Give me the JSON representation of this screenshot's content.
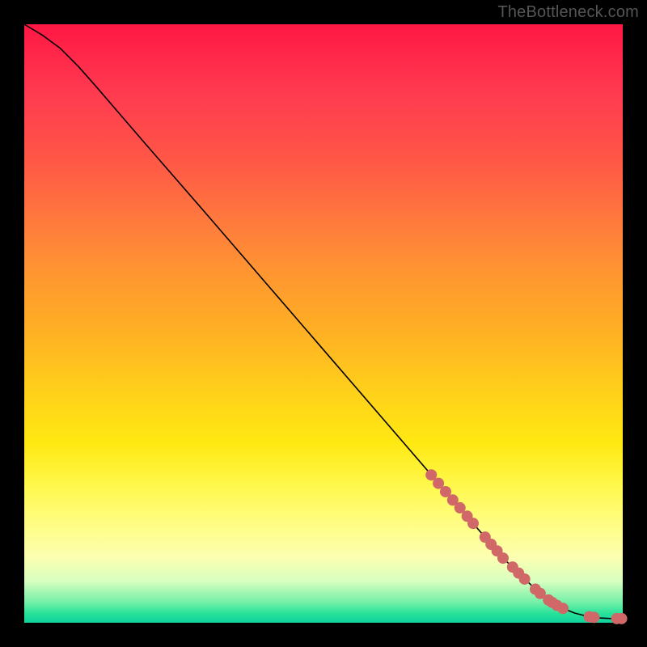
{
  "watermark": "TheBottleneck.com",
  "colors": {
    "black": "#000000",
    "marker": "#d16868",
    "gradient_top": "#ff1744",
    "gradient_bottom": "#0fd29c"
  },
  "chart_data": {
    "type": "line",
    "title": "",
    "xlabel": "",
    "ylabel": "",
    "xlim": [
      0,
      100
    ],
    "ylim": [
      0,
      100
    ],
    "series": [
      {
        "name": "curve",
        "x": [
          0,
          3,
          6,
          9,
          12,
          20,
          30,
          40,
          50,
          60,
          70,
          80,
          85,
          88,
          90,
          92,
          94,
          96,
          98,
          100
        ],
        "y": [
          100,
          98.2,
          96.0,
          93.0,
          89.6,
          80.3,
          68.8,
          57.2,
          45.6,
          34.0,
          22.4,
          10.8,
          6.0,
          3.6,
          2.4,
          1.6,
          1.1,
          0.8,
          0.7,
          0.7
        ]
      }
    ],
    "markers": {
      "name": "highlight-points",
      "points": [
        {
          "x": 68,
          "y": 24.7
        },
        {
          "x": 69.2,
          "y": 23.3
        },
        {
          "x": 70.4,
          "y": 21.9
        },
        {
          "x": 71.6,
          "y": 20.5
        },
        {
          "x": 72.8,
          "y": 19.2
        },
        {
          "x": 74.0,
          "y": 17.8
        },
        {
          "x": 75.0,
          "y": 16.6
        },
        {
          "x": 77.0,
          "y": 14.3
        },
        {
          "x": 78.0,
          "y": 13.1
        },
        {
          "x": 79.0,
          "y": 12.0
        },
        {
          "x": 80.0,
          "y": 10.8
        },
        {
          "x": 81.6,
          "y": 9.3
        },
        {
          "x": 82.6,
          "y": 8.3
        },
        {
          "x": 83.6,
          "y": 7.3
        },
        {
          "x": 85.4,
          "y": 5.6
        },
        {
          "x": 86.2,
          "y": 4.9
        },
        {
          "x": 87.6,
          "y": 3.8
        },
        {
          "x": 88.2,
          "y": 3.4
        },
        {
          "x": 89.0,
          "y": 2.9
        },
        {
          "x": 90.0,
          "y": 2.4
        },
        {
          "x": 94.4,
          "y": 1.0
        },
        {
          "x": 95.2,
          "y": 0.9
        },
        {
          "x": 99.0,
          "y": 0.7
        },
        {
          "x": 99.8,
          "y": 0.7
        }
      ]
    }
  }
}
